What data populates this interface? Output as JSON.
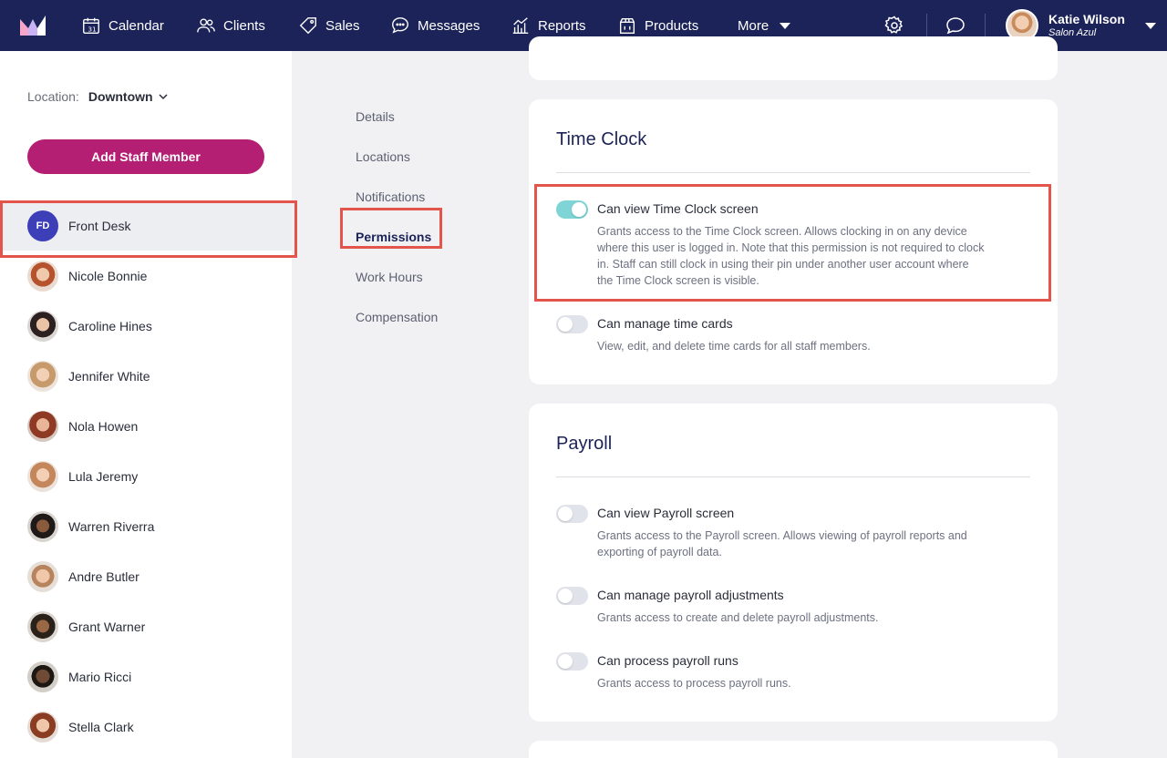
{
  "nav": {
    "items": [
      {
        "label": "Calendar",
        "icon": "calendar-icon"
      },
      {
        "label": "Clients",
        "icon": "clients-icon"
      },
      {
        "label": "Sales",
        "icon": "tag-icon"
      },
      {
        "label": "Messages",
        "icon": "chat-bubble-icon"
      },
      {
        "label": "Reports",
        "icon": "bar-chart-icon"
      },
      {
        "label": "Products",
        "icon": "box-icon"
      },
      {
        "label": "More",
        "icon": "chevron-down-icon"
      }
    ],
    "user": {
      "name": "Katie Wilson",
      "salon": "Salon Azul"
    },
    "colors": {
      "bar": "#1b2358",
      "accent": "#b41f73",
      "highlight": "#e3554a",
      "toggle_on": "#7fd4d5"
    }
  },
  "sidebar": {
    "location_label": "Location:",
    "location_value": "Downtown",
    "add_button": "Add Staff Member",
    "staff": [
      {
        "name": "Front Desk",
        "initials": "FD",
        "active": true
      },
      {
        "name": "Nicole Bonnie"
      },
      {
        "name": "Caroline Hines"
      },
      {
        "name": "Jennifer White"
      },
      {
        "name": "Nola Howen"
      },
      {
        "name": "Lula Jeremy"
      },
      {
        "name": "Warren Riverra"
      },
      {
        "name": "Andre Butler"
      },
      {
        "name": "Grant Warner"
      },
      {
        "name": "Mario Ricci"
      },
      {
        "name": "Stella Clark"
      }
    ]
  },
  "subnav": {
    "items": [
      "Details",
      "Locations",
      "Notifications",
      "Permissions",
      "Work Hours",
      "Compensation"
    ],
    "active": "Permissions"
  },
  "time_clock": {
    "title": "Time Clock",
    "perms": [
      {
        "title": "Can view Time Clock screen",
        "desc": "Grants access to the Time Clock screen. Allows clocking in on any device where this user is logged in. Note that this permission is not required to clock in. Staff can still clock in using their pin under another user account where the Time Clock screen is visible.",
        "on": true
      },
      {
        "title": "Can manage time cards",
        "desc": "View, edit, and delete time cards for all staff members.",
        "on": false
      }
    ]
  },
  "payroll": {
    "title": "Payroll",
    "perms": [
      {
        "title": "Can view Payroll screen",
        "desc": "Grants access to the Payroll screen. Allows viewing of payroll reports and exporting of payroll data.",
        "on": false
      },
      {
        "title": "Can manage payroll adjustments",
        "desc": "Grants access to create and delete payroll adjustments.",
        "on": false
      },
      {
        "title": "Can process payroll runs",
        "desc": "Grants access to process payroll runs.",
        "on": false
      }
    ]
  }
}
